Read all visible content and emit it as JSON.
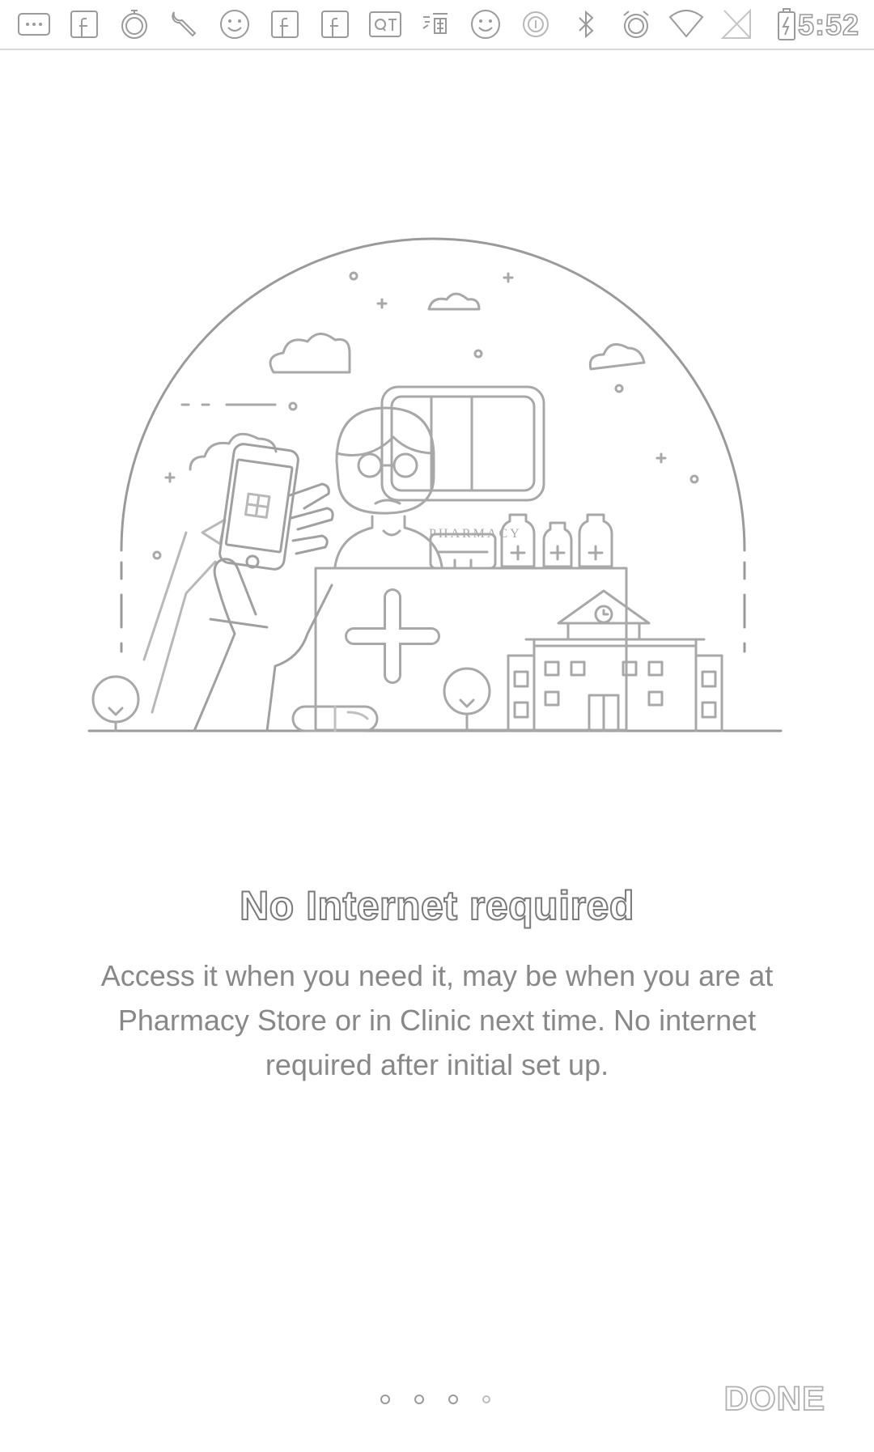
{
  "status_bar": {
    "icons": [
      "more-icon",
      "facebook-icon",
      "timer-icon",
      "wrench-icon",
      "smiley-icon",
      "facebook-icon",
      "facebook-icon",
      "qt-icon",
      "taobao-icon",
      "smiley-icon",
      "circle-icon",
      "bluetooth-icon",
      "alarm-icon",
      "wifi-icon",
      "no-sim-icon",
      "battery-charging-icon"
    ],
    "time": "5:52"
  },
  "illustration": {
    "sign_text": "PHARMACY"
  },
  "onboarding": {
    "title": "No Internet required",
    "description": "Access it when you need it, may be when you are at Pharmacy Store or in Clinic next time. No internet required after initial set up.",
    "page_indicator": {
      "count": 4,
      "active_index": 3
    },
    "done_label": "DONE"
  },
  "colors": {
    "outline": "#9a9a9a",
    "text": "#888888",
    "background": "#ffffff"
  }
}
